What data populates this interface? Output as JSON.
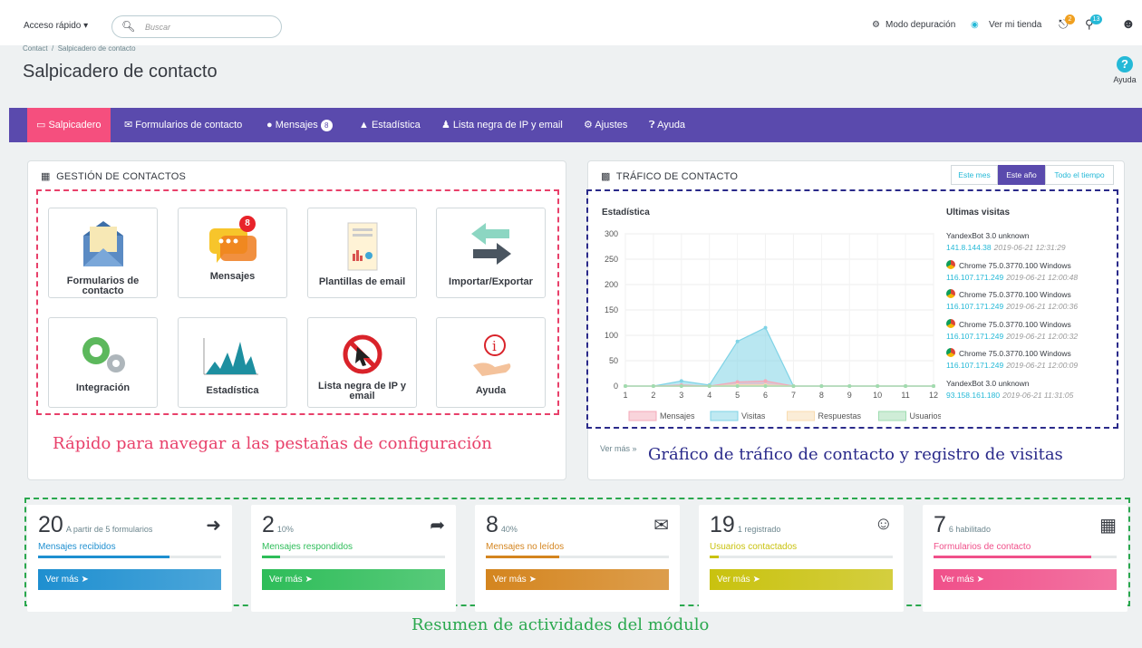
{
  "topbar": {
    "quick_access": "Acceso rápido ▾",
    "search_placeholder": "Buscar",
    "debug": "Modo depuración",
    "view_store": "Ver mi tienda",
    "notif_orders": "2",
    "notif_customers": "13"
  },
  "breadcrumb": {
    "first": "Contact",
    "sep": "/",
    "current": "Salpicadero de contacto"
  },
  "page_title": "Salpicadero de contacto",
  "help_label": "Ayuda",
  "nav": {
    "dashboard": "Salpicadero",
    "forms": "Formularios de contacto",
    "messages": "Mensajes",
    "messages_count": "8",
    "stats": "Estadística",
    "blacklist": "Lista negra de IP y email",
    "settings": "Ajustes",
    "help": "Ayuda"
  },
  "contact_mgmt": {
    "title": "GESTIÓN DE CONTACTOS",
    "tiles": [
      "Formularios de contacto",
      "Mensajes",
      "Plantillas de email",
      "Importar/Exportar",
      "Integración",
      "Estadística",
      "Lista negra de IP y email",
      "Ayuda"
    ],
    "messages_badge": "8"
  },
  "annotations": {
    "left": "Rápido para navegar a las pestañas de configuración",
    "right": "Gráfico de tráfico de contacto y registro de visitas",
    "bottom": "Resumen de actividades del módulo"
  },
  "traffic": {
    "title": "TRÁFICO DE CONTACTO",
    "range": [
      "Este mes",
      "Este año",
      "Todo el tiempo"
    ],
    "stats_label": "Estadística",
    "recent_label": "Ultimas visitas",
    "more": "Ver más »",
    "visits": [
      {
        "agent": "YandexBot 3.0 unknown",
        "ip": "141.8.144.38",
        "time": "2019-06-21 12:31:29",
        "chrome": false
      },
      {
        "agent": "Chrome 75.0.3770.100 Windows",
        "ip": "116.107.171.249",
        "time": "2019-06-21 12:00:48",
        "chrome": true
      },
      {
        "agent": "Chrome 75.0.3770.100 Windows",
        "ip": "116.107.171.249",
        "time": "2019-06-21 12:00:36",
        "chrome": true
      },
      {
        "agent": "Chrome 75.0.3770.100 Windows",
        "ip": "116.107.171.249",
        "time": "2019-06-21 12:00:32",
        "chrome": true
      },
      {
        "agent": "Chrome 75.0.3770.100 Windows",
        "ip": "116.107.171.249",
        "time": "2019-06-21 12:00:09",
        "chrome": true
      },
      {
        "agent": "YandexBot 3.0 unknown",
        "ip": "93.158.161.180",
        "time": "2019-06-21 11:31:05",
        "chrome": false
      }
    ]
  },
  "chart_data": {
    "type": "area",
    "x": [
      1,
      2,
      3,
      4,
      5,
      6,
      7,
      8,
      9,
      10,
      11,
      12
    ],
    "ylim": [
      0,
      300
    ],
    "yticks": [
      0,
      50,
      100,
      150,
      200,
      250,
      300
    ],
    "series": [
      {
        "name": "Mensajes",
        "color": "#f4a9b8",
        "values": [
          0,
          0,
          2,
          0,
          8,
          10,
          0,
          0,
          0,
          0,
          0,
          0
        ]
      },
      {
        "name": "Visitas",
        "color": "#7fd3e6",
        "values": [
          0,
          0,
          10,
          2,
          88,
          115,
          0,
          0,
          0,
          0,
          0,
          0
        ]
      },
      {
        "name": "Respuestas",
        "color": "#f8dcb0",
        "values": [
          0,
          0,
          0,
          0,
          2,
          2,
          0,
          0,
          0,
          0,
          0,
          0
        ]
      },
      {
        "name": "Usuarios",
        "color": "#9fdcb0",
        "values": [
          0,
          0,
          0,
          0,
          0,
          0,
          0,
          0,
          0,
          0,
          0,
          0
        ]
      }
    ]
  },
  "summary": [
    {
      "num": "20",
      "sub": "A partir de 5 formularios",
      "label": "Mensajes recibidos",
      "color": "#1e8fd0",
      "btn": "Ver más",
      "progress": 0.72
    },
    {
      "num": "2",
      "sub": "10%",
      "label": "Mensajes respondidos",
      "color": "#2ebd59",
      "btn": "Ver más",
      "progress": 0.1
    },
    {
      "num": "8",
      "sub": "40%",
      "label": "Mensajes no leídos",
      "color": "#d4851f",
      "btn": "Ver más",
      "progress": 0.4
    },
    {
      "num": "19",
      "sub": "1 registrado",
      "label": "Usuarios contactados",
      "color": "#c9c20f",
      "btn": "Ver más",
      "progress": 0.05
    },
    {
      "num": "7",
      "sub": "6 habilitado",
      "label": "Formularios de contacto",
      "color": "#f0508a",
      "btn": "Ver más",
      "progress": 0.86
    }
  ]
}
